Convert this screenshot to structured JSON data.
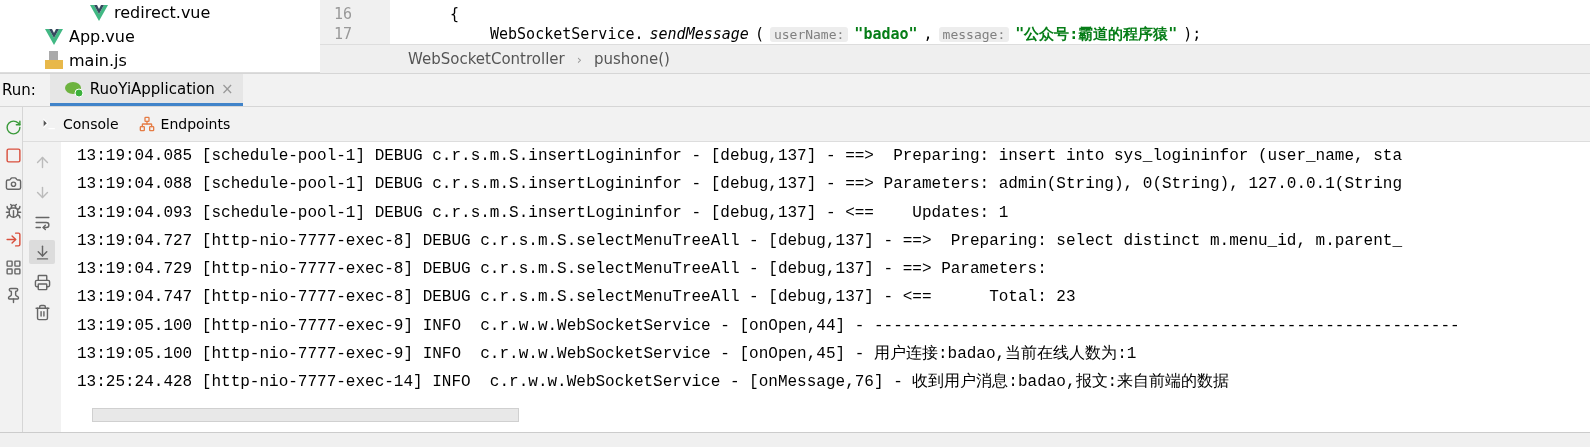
{
  "project_tree": [
    {
      "children": [
        {
          "name": "redirect.vue",
          "kind": "vue"
        }
      ]
    },
    {
      "name": "App.vue",
      "kind": "vue"
    },
    {
      "name": "main.js",
      "kind": "js"
    }
  ],
  "editor": {
    "lines": [
      {
        "number": "16",
        "tokens": [
          {
            "kind": "plain",
            "text": "{"
          }
        ]
      },
      {
        "number": "17",
        "tokens": [
          {
            "kind": "plain",
            "text": "WebSocketService."
          },
          {
            "kind": "italic",
            "text": "sendMessage"
          },
          {
            "kind": "plain",
            "text": "("
          },
          {
            "kind": "hint",
            "text": "userName:"
          },
          {
            "kind": "string",
            "text": "\"badao\""
          },
          {
            "kind": "plain",
            "text": ","
          },
          {
            "kind": "hint",
            "text": "message:"
          },
          {
            "kind": "string",
            "text": "\"公众号:霸道的程序猿\""
          },
          {
            "kind": "plain",
            "text": ");"
          }
        ]
      }
    ],
    "breadcrumb": {
      "items": [
        "WebSocketController",
        "pushone()"
      ],
      "separator": "›"
    }
  },
  "run_bar": {
    "label": "Run:",
    "tabs": [
      {
        "label": "RuoYiApplication",
        "selected": true,
        "close": "×"
      }
    ]
  },
  "run_tools": [
    {
      "kind": "rerun"
    },
    {
      "kind": "stop"
    },
    {
      "kind": "camera"
    },
    {
      "kind": "debug"
    },
    {
      "kind": "login"
    },
    {
      "kind": "layout"
    },
    {
      "kind": "pin"
    }
  ],
  "console_tabs": [
    {
      "label": "Console",
      "kind": "console"
    },
    {
      "label": "Endpoints",
      "kind": "endpoints"
    }
  ],
  "console_tools": [
    {
      "kind": "up",
      "disabled": true,
      "on": false
    },
    {
      "kind": "down",
      "disabled": true,
      "on": false
    },
    {
      "kind": "wrap",
      "disabled": false,
      "on": false
    },
    {
      "kind": "scroll-end",
      "disabled": false,
      "on": true
    },
    {
      "kind": "print",
      "disabled": false,
      "on": false
    },
    {
      "kind": "trash",
      "disabled": false,
      "on": false
    }
  ],
  "log_lines": [
    "13:19:04.085 [schedule-pool-1] DEBUG c.r.s.m.S.insertLogininfor - [debug,137] - ==>  Preparing: insert into sys_logininfor (user_name, sta",
    "13:19:04.088 [schedule-pool-1] DEBUG c.r.s.m.S.insertLogininfor - [debug,137] - ==> Parameters: admin(String), 0(String), 127.0.0.1(String",
    "13:19:04.093 [schedule-pool-1] DEBUG c.r.s.m.S.insertLogininfor - [debug,137] - <==    Updates: 1",
    "13:19:04.727 [http-nio-7777-exec-8] DEBUG c.r.s.m.S.selectMenuTreeAll - [debug,137] - ==>  Preparing: select distinct m.menu_id, m.parent_",
    "13:19:04.729 [http-nio-7777-exec-8] DEBUG c.r.s.m.S.selectMenuTreeAll - [debug,137] - ==> Parameters: ",
    "13:19:04.747 [http-nio-7777-exec-8] DEBUG c.r.s.m.S.selectMenuTreeAll - [debug,137] - <==      Total: 23",
    "13:19:05.100 [http-nio-7777-exec-9] INFO  c.r.w.w.WebSocketService - [onOpen,44] - -------------------------------------------------------------",
    "13:19:05.100 [http-nio-7777-exec-9] INFO  c.r.w.w.WebSocketService - [onOpen,45] - 用户连接:badao,当前在线人数为:1",
    "13:25:24.428 [http-nio-7777-exec-14] INFO  c.r.w.w.WebSocketService - [onMessage,76] - 收到用户消息:badao,报文:来自前端的数据"
  ]
}
